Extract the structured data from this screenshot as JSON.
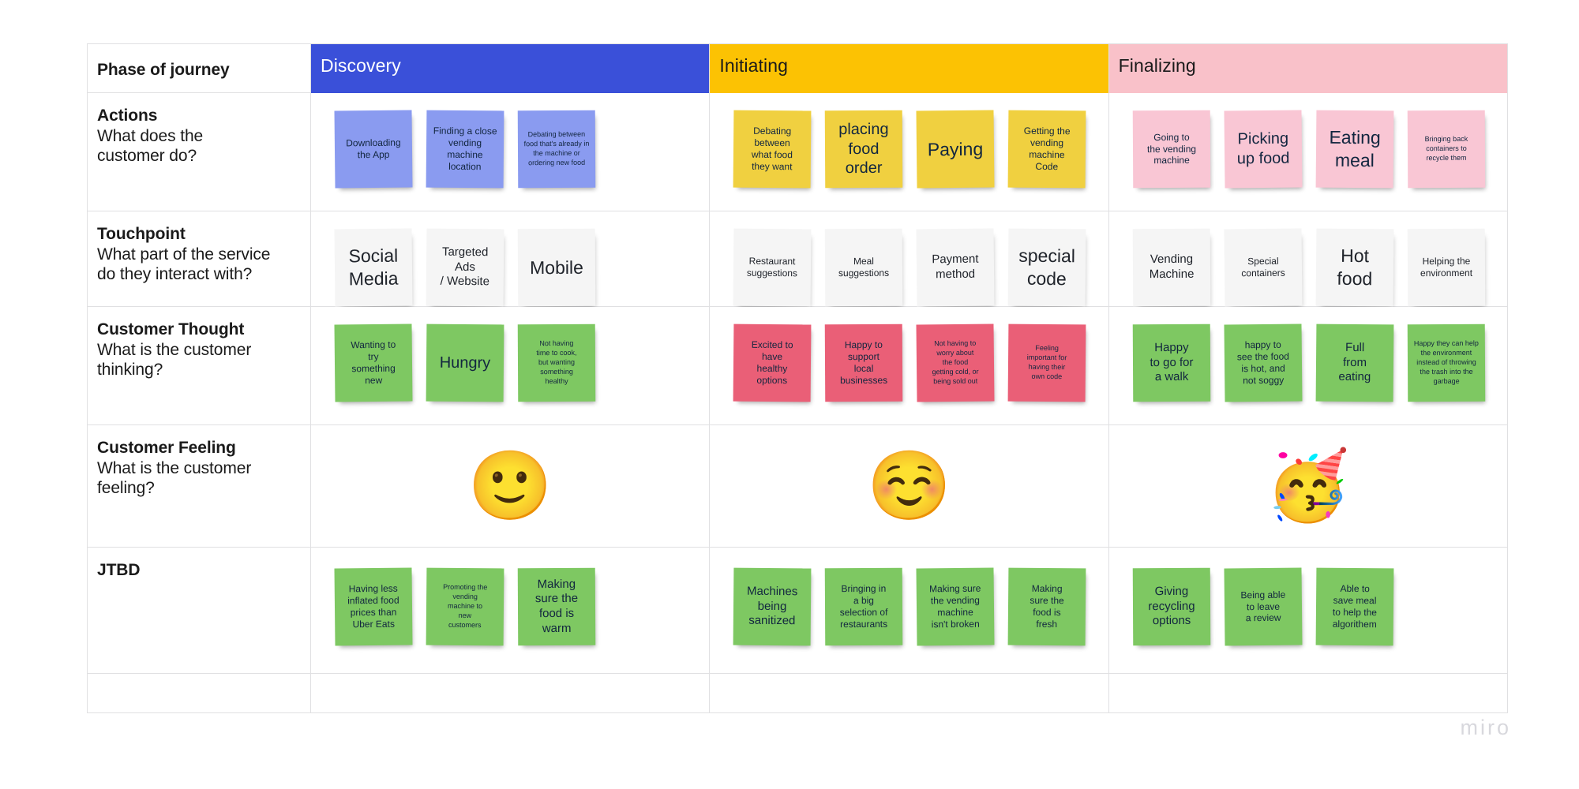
{
  "board": {
    "watermark": "miro",
    "colors": {
      "discovery": "#3a50d9",
      "initiating": "#fcc203",
      "finalizing": "#f9c1c9",
      "note_blue": "#8a9bf0",
      "note_yellow": "#f0d040",
      "note_pink": "#f9c6d4",
      "note_white": "#f5f5f5",
      "note_green": "#7ec862",
      "note_red": "#ea5f77",
      "grid_line": "#e0e0e2"
    }
  },
  "header": {
    "label": "Phase of journey",
    "phases": [
      {
        "name": "Discovery",
        "color": "#3a50d9",
        "text_light": true
      },
      {
        "name": "Initiating",
        "color": "#fcc203",
        "text_light": false
      },
      {
        "name": "Finalizing",
        "color": "#f9c1c9",
        "text_light": false
      }
    ]
  },
  "rows": [
    {
      "key": "actions",
      "title": "Actions",
      "subtitle": "What does the\ncustomer do?",
      "columns": [
        {
          "phase": "Discovery",
          "note_color": "#8a9bf0",
          "notes": [
            {
              "text": "Downloading\nthe App",
              "size": "sm"
            },
            {
              "text": "Finding a close\nvending\nmachine\nlocation",
              "size": "sm"
            },
            {
              "text": "Debating between food that's already in the machine or ordering new food",
              "size": "xs"
            }
          ]
        },
        {
          "phase": "Initiating",
          "note_color": "#f0d040",
          "notes": [
            {
              "text": "Debating\nbetween\nwhat food\nthey want",
              "size": "sm"
            },
            {
              "text": "placing\nfood\norder",
              "size": "lg"
            },
            {
              "text": "Paying",
              "size": "xl"
            },
            {
              "text": "Getting the\nvending\nmachine\nCode",
              "size": "sm"
            }
          ]
        },
        {
          "phase": "Finalizing",
          "note_color": "#f9c6d4",
          "notes": [
            {
              "text": "Going to\nthe vending\nmachine",
              "size": "sm"
            },
            {
              "text": "Picking\nup food",
              "size": "lg"
            },
            {
              "text": "Eating\nmeal",
              "size": "xl"
            },
            {
              "text": "Bringing back\ncontainers to\nrecycle them",
              "size": "xs"
            }
          ]
        }
      ]
    },
    {
      "key": "touchpoint",
      "title": "Touchpoint",
      "subtitle": "What part of the service\ndo they interact with?",
      "columns": [
        {
          "phase": "Discovery",
          "note_color": "#f5f5f5",
          "notes": [
            {
              "text": "Social\nMedia",
              "size": "xl"
            },
            {
              "text": "Targeted\nAds\n/ Website",
              "size": "md"
            },
            {
              "text": "Mobile",
              "size": "xl"
            }
          ]
        },
        {
          "phase": "Initiating",
          "note_color": "#f5f5f5",
          "notes": [
            {
              "text": "Restaurant\nsuggestions",
              "size": "sm"
            },
            {
              "text": "Meal\nsuggestions",
              "size": "sm"
            },
            {
              "text": "Payment\nmethod",
              "size": "md"
            },
            {
              "text": "special\ncode",
              "size": "xl"
            }
          ]
        },
        {
          "phase": "Finalizing",
          "note_color": "#f5f5f5",
          "notes": [
            {
              "text": "Vending\nMachine",
              "size": "md"
            },
            {
              "text": "Special\ncontainers",
              "size": "sm"
            },
            {
              "text": "Hot\nfood",
              "size": "xl"
            },
            {
              "text": "Helping the\nenvironment",
              "size": "sm"
            }
          ]
        }
      ]
    },
    {
      "key": "thought",
      "title": "Customer Thought",
      "subtitle": "What is the customer\nthinking?",
      "columns": [
        {
          "phase": "Discovery",
          "note_color": "#7ec862",
          "notes": [
            {
              "text": "Wanting to\ntry\nsomething\nnew",
              "size": "sm"
            },
            {
              "text": "Hungry",
              "size": "lg"
            },
            {
              "text": "Not having\ntime to cook,\nbut wanting\nsomething\nhealthy",
              "size": "xs"
            }
          ]
        },
        {
          "phase": "Initiating",
          "note_color": "#ea5f77",
          "notes": [
            {
              "text": "Excited to\nhave\nhealthy\noptions",
              "size": "sm"
            },
            {
              "text": "Happy to\nsupport\nlocal\nbusinesses",
              "size": "sm"
            },
            {
              "text": "Not having to\nworry about\nthe food\ngetting cold, or\nbeing sold out",
              "size": "xs"
            },
            {
              "text": "Feeling\nimportant for\nhaving their\nown code",
              "size": "xs"
            }
          ]
        },
        {
          "phase": "Finalizing",
          "note_color": "#7ec862",
          "notes": [
            {
              "text": "Happy\nto go for\na walk",
              "size": "md"
            },
            {
              "text": "happy to\nsee the food\nis hot, and\nnot soggy",
              "size": "sm"
            },
            {
              "text": "Full\nfrom\neating",
              "size": "md"
            },
            {
              "text": "Happy they can help the environment instead of throwing the trash into the garbage",
              "size": "xs"
            }
          ]
        }
      ]
    },
    {
      "key": "feeling",
      "title": "Customer Feeling",
      "subtitle": "What is the customer\nfeeling?",
      "emoji_columns": [
        {
          "phase": "Discovery",
          "emoji": "🙂",
          "name": "slightly-smiling-face-emoji"
        },
        {
          "phase": "Initiating",
          "emoji": "☺️",
          "name": "smiling-face-emoji"
        },
        {
          "phase": "Finalizing",
          "emoji": "🥳",
          "name": "partying-face-emoji"
        }
      ]
    },
    {
      "key": "jtbd",
      "title": "JTBD",
      "subtitle": "",
      "columns": [
        {
          "phase": "Discovery",
          "note_color": "#7ec862",
          "notes": [
            {
              "text": "Having less\ninflated food\nprices than\nUber Eats",
              "size": "sm"
            },
            {
              "text": "Promoting the\nvending\nmachine to\nnew\ncustomers",
              "size": "xs"
            },
            {
              "text": "Making\nsure the\nfood is\nwarm",
              "size": "md"
            }
          ]
        },
        {
          "phase": "Initiating",
          "note_color": "#7ec862",
          "notes": [
            {
              "text": "Machines\nbeing\nsanitized",
              "size": "md"
            },
            {
              "text": "Bringing in\na big\nselection of\nrestaurants",
              "size": "sm"
            },
            {
              "text": "Making sure\nthe vending\nmachine\nisn't broken",
              "size": "sm"
            },
            {
              "text": "Making\nsure the\nfood is\nfresh",
              "size": "sm"
            }
          ]
        },
        {
          "phase": "Finalizing",
          "note_color": "#7ec862",
          "notes": [
            {
              "text": "Giving\nrecycling\noptions",
              "size": "md"
            },
            {
              "text": "Being able\nto leave\na review",
              "size": "sm"
            },
            {
              "text": "Able to\nsave meal\nto help the\nalgorithem",
              "size": "sm"
            }
          ]
        }
      ]
    }
  ]
}
